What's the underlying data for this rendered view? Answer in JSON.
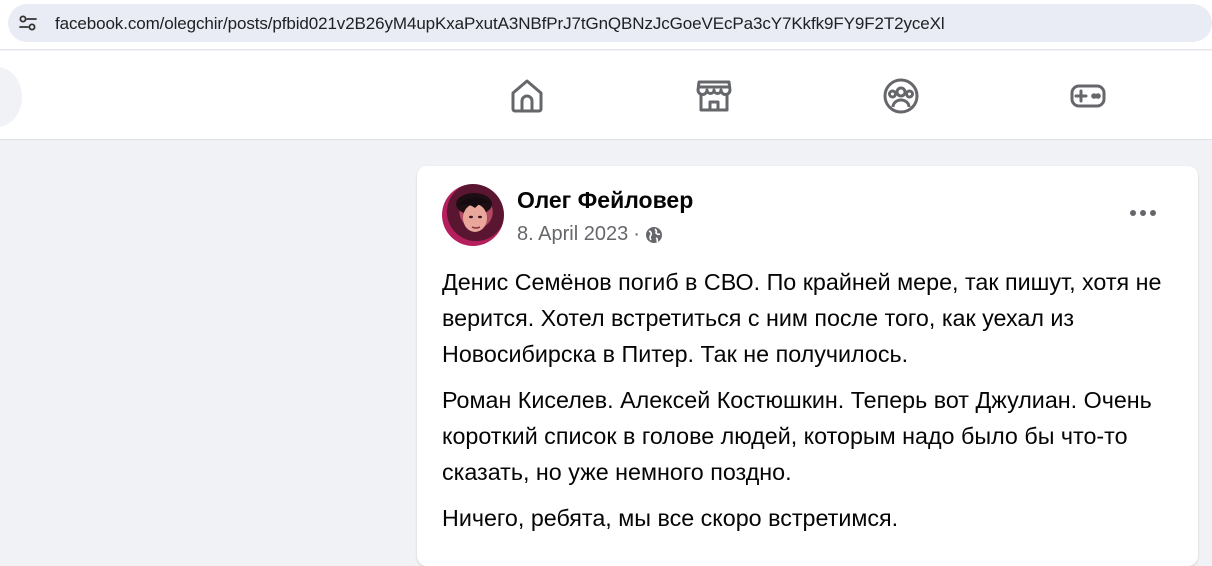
{
  "browser": {
    "url": "facebook.com/olegchir/posts/pfbid021v2B26yM4upKxaPxutA3NBfPrJ7tGnQBNzJcGoeVEcPa3cY7Kkfk9FY9F2T2yceXl",
    "site_info_icon": "tune-icon"
  },
  "nav": {
    "items": [
      {
        "icon": "home-icon"
      },
      {
        "icon": "marketplace-icon"
      },
      {
        "icon": "groups-icon"
      },
      {
        "icon": "gaming-icon"
      }
    ]
  },
  "post": {
    "author": "Олег Фейловер",
    "date": "8. April 2023",
    "separator": "·",
    "audience_icon": "globe-icon",
    "more_icon": "more-options-icon",
    "paragraphs": [
      "Денис Семёнов погиб в СВО. По крайней мере, так пишут, хотя не верится. Хотел встретиться с ним после того, как уехал из Новосибирска в Питер. Так не получилось.",
      "Роман Киселев. Алексей Костюшкин. Теперь вот Джулиан. Очень короткий список в голове людей, которым надо было бы что-то сказать, но уже немного поздно.",
      "Ничего, ребята, мы все скоро встретимся."
    ]
  }
}
